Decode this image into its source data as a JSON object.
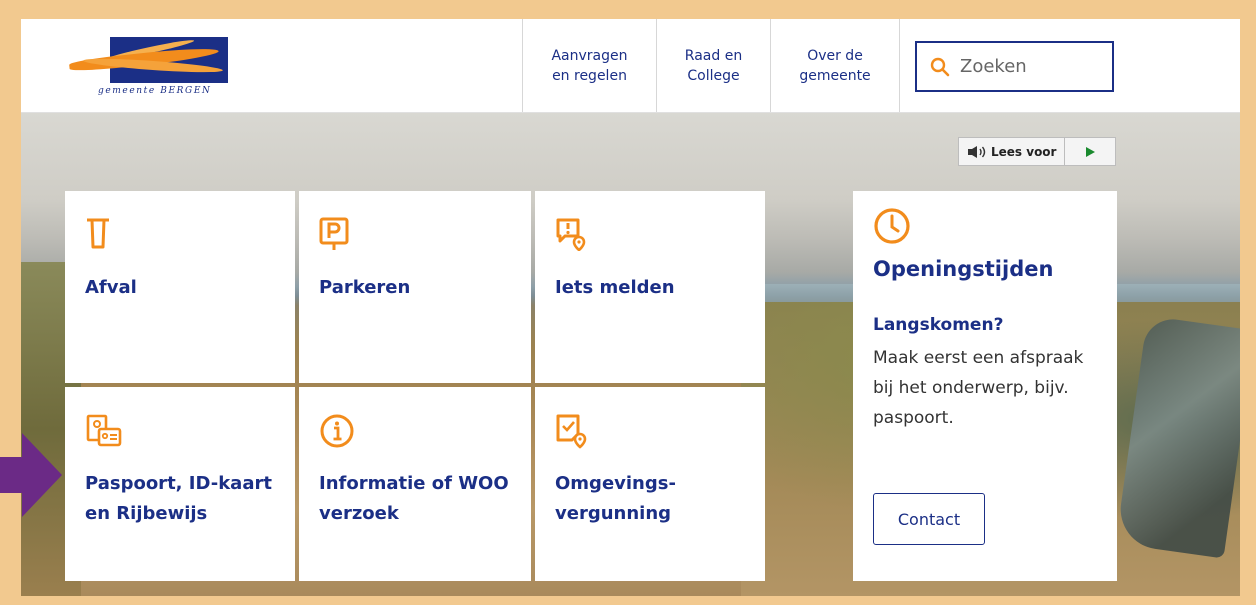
{
  "header": {
    "logo_text": "gemeente BERGEN",
    "nav": [
      {
        "label": "Aanvragen\nen regelen"
      },
      {
        "label": "Raad en\nCollege"
      },
      {
        "label": "Over de\ngemeente"
      }
    ],
    "search": {
      "placeholder": "Zoeken",
      "icon": "search-icon"
    }
  },
  "read_aloud": {
    "label": "Lees voor",
    "icon": "speaker-icon",
    "play_icon": "play-icon"
  },
  "tiles": [
    {
      "label": "Afval",
      "icon": "waste-bin-icon"
    },
    {
      "label": "Parkeren",
      "icon": "parking-icon"
    },
    {
      "label": "Iets melden",
      "icon": "report-issue-icon"
    },
    {
      "label": "Paspoort, ID-kaart\nen Rijbewijs",
      "icon": "id-documents-icon"
    },
    {
      "label": "Informatie of WOO\nverzoek",
      "icon": "info-icon"
    },
    {
      "label": "Omgevings-\nvergunning",
      "icon": "permit-location-icon"
    }
  ],
  "opening_hours": {
    "icon": "clock-icon",
    "title": "Openingstijden",
    "subtitle": "Langskomen?",
    "text": "Maak eerst een afspraak bij het onderwerp, bijv. paspoort.",
    "button": "Contact"
  },
  "colors": {
    "brand_blue": "#1b2f86",
    "accent_orange": "#f28c1c",
    "pointer_purple": "#6b2a86",
    "frame": "#f2c98f"
  }
}
